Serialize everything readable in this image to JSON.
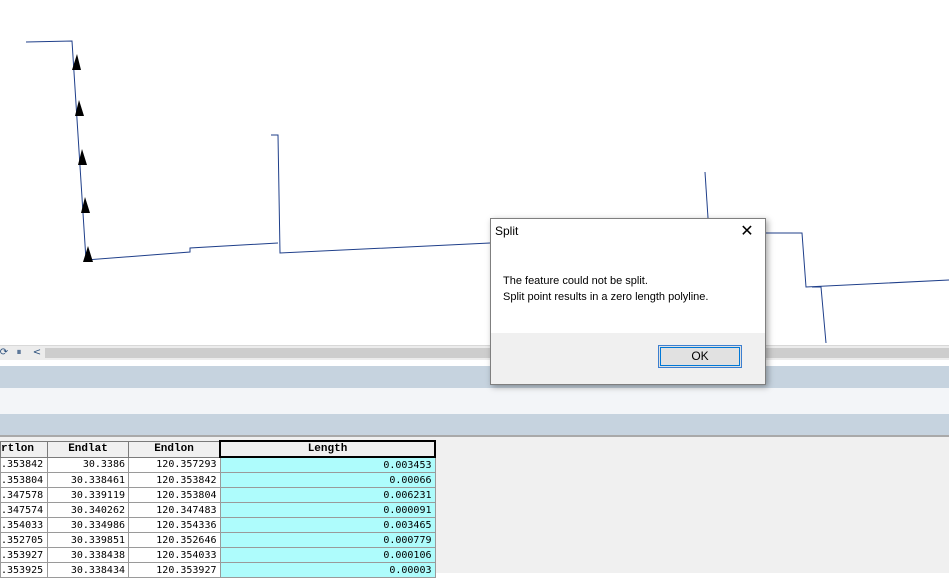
{
  "dialog": {
    "title": "Split",
    "close_glyph": "✕",
    "message_line1": "The feature could not be split.",
    "message_line2": "Split point results in a zero length polyline.",
    "ok_label": "OK"
  },
  "nav": {
    "refresh_glyph": "⟳",
    "pause_glyph": "⏸",
    "prev_glyph": "<"
  },
  "table": {
    "columns": [
      "rtlon",
      "Endlat",
      "Endlon",
      "Length"
    ],
    "rows": [
      [
        ".353842",
        "30.3386",
        "120.357293",
        "0.003453"
      ],
      [
        ".353804",
        "30.338461",
        "120.353842",
        "0.00066"
      ],
      [
        ".347578",
        "30.339119",
        "120.353804",
        "0.006231"
      ],
      [
        ".347574",
        "30.340262",
        "120.347483",
        "0.000091"
      ],
      [
        ".354033",
        "30.334986",
        "120.354336",
        "0.003465"
      ],
      [
        ".352705",
        "30.339851",
        "120.352646",
        "0.000779"
      ],
      [
        ".353927",
        "30.338438",
        "120.354033",
        "0.000106"
      ],
      [
        ".353925",
        "30.338434",
        "120.353927",
        "0.00003"
      ]
    ]
  },
  "colors": {
    "line": "#1f3f8a",
    "highlight_cell": "#aefcfc",
    "band": "#c6d3df"
  }
}
